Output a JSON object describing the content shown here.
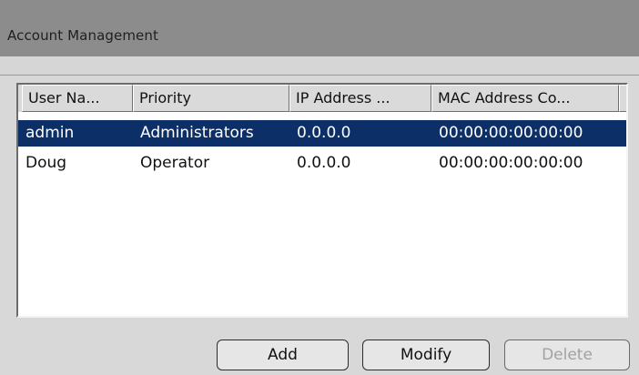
{
  "window": {
    "title": "Account Management"
  },
  "table": {
    "headers": [
      "User Na...",
      "Priority",
      "IP Address ...",
      "MAC Address Co..."
    ],
    "rows": [
      {
        "user_name": "admin",
        "priority": "Administrators",
        "ip_address": "0.0.0.0",
        "mac_address": "00:00:00:00:00:00",
        "selected": true
      },
      {
        "user_name": "Doug",
        "priority": "Operator",
        "ip_address": "0.0.0.0",
        "mac_address": "00:00:00:00:00:00",
        "selected": false
      }
    ]
  },
  "buttons": {
    "add": "Add",
    "modify": "Modify",
    "delete": "Delete",
    "delete_enabled": false
  },
  "colors": {
    "selected_row": "#0d2f67",
    "title_bar": "#8c8c8c",
    "window_background": "#d8d8d8",
    "disabled_text": "#a2a2a2"
  }
}
